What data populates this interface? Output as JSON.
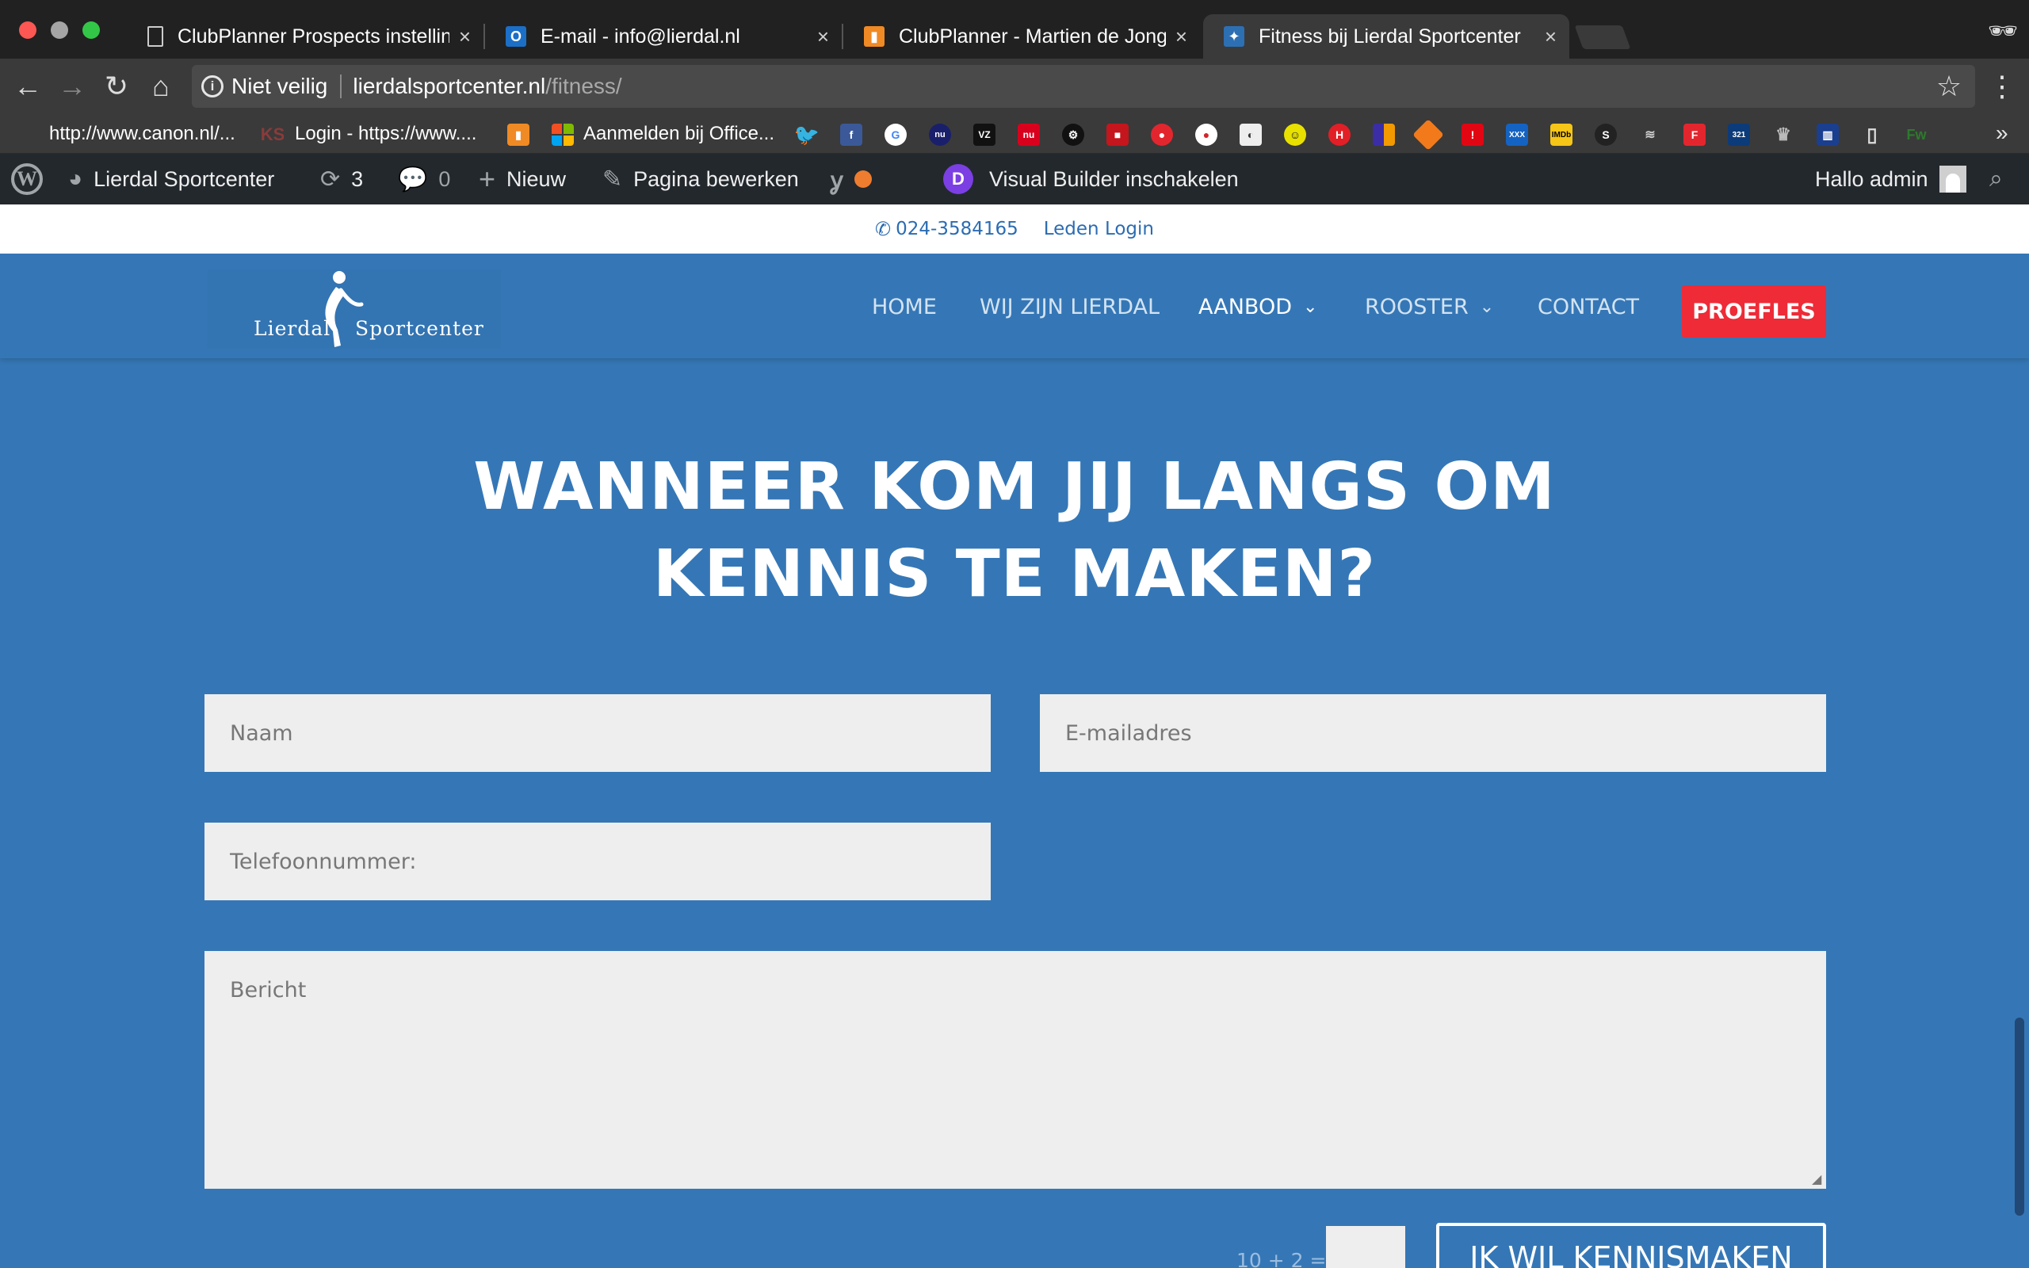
{
  "browser": {
    "tabs": [
      {
        "title": "ClubPlanner Prospects instellingen",
        "icon": "document-icon",
        "active": false
      },
      {
        "title": "E-mail - info@lierdal.nl",
        "icon": "outlook-icon",
        "active": false
      },
      {
        "title": "ClubPlanner - Martien de Jong",
        "icon": "clubplanner-icon",
        "active": false
      },
      {
        "title": "Fitness bij Lierdal Sportcenter",
        "icon": "lierdal-favicon",
        "active": true
      }
    ],
    "tab_close": "×",
    "address": {
      "security": "Niet veilig",
      "host": "lierdalsportcenter.nl",
      "path": "/fitness/"
    },
    "bookmarks": [
      {
        "label": "http://www.canon.nl/..."
      },
      {
        "label": "Login - https://www...."
      },
      {
        "label": "Aanmelden bij Office..."
      }
    ],
    "bookmarks_more": "»"
  },
  "admin_bar": {
    "site_name": "Lierdal Sportcenter",
    "updates": "3",
    "comments": "0",
    "new_label": "Nieuw",
    "edit_label": "Pagina bewerken",
    "visual_builder_label": "Visual Builder inschakelen",
    "greeting": "Hallo admin",
    "divi_letter": "D"
  },
  "site": {
    "phone": "024-3584165",
    "login_label": "Leden Login",
    "logo": {
      "word_left": "Lierdal",
      "word_right": "Sportcenter"
    },
    "nav": [
      {
        "label": "HOME",
        "dropdown": false,
        "active": false
      },
      {
        "label": "WIJ ZIJN LIERDAL",
        "dropdown": false,
        "active": false
      },
      {
        "label": "AANBOD",
        "dropdown": true,
        "active": true
      },
      {
        "label": "ROOSTER",
        "dropdown": true,
        "active": false
      },
      {
        "label": "CONTACT",
        "dropdown": false,
        "active": false
      }
    ],
    "cta_label": "PROEFLES",
    "headline_line1": "WANNEER KOM JIJ LANGS OM",
    "headline_line2": "KENNIS TE MAKEN?",
    "form": {
      "name_placeholder": "Naam",
      "email_placeholder": "E-mailadres",
      "phone_placeholder": "Telefoonnummer:",
      "message_placeholder": "Bericht",
      "captcha_label": "10 + 2 =",
      "submit_label": "IK WIL KENNISMAKEN"
    }
  },
  "colors": {
    "brand_blue": "#3577b6",
    "cta_red": "#ee2b37",
    "field_gray": "#eeeeee",
    "wp_bar": "#23282d"
  }
}
